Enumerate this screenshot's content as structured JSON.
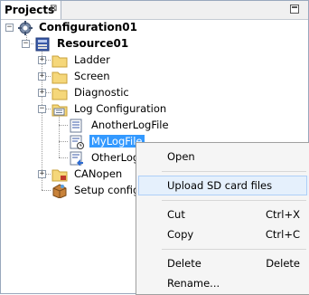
{
  "panel": {
    "title": "Projects",
    "close_glyph": "⊠"
  },
  "tree": {
    "root": "Configuration01",
    "resource": "Resource01",
    "folders": [
      "Ladder",
      "Screen",
      "Diagnostic",
      "Log Configuration"
    ],
    "log_files": [
      "AnotherLogFile",
      "MyLogFile",
      "OtherLogF"
    ],
    "after": [
      "CANopen",
      "Setup configu"
    ]
  },
  "context_menu": {
    "open": "Open",
    "upload": "Upload SD card files",
    "cut": "Cut",
    "cut_sc": "Ctrl+X",
    "copy": "Copy",
    "copy_sc": "Ctrl+C",
    "delete": "Delete",
    "delete_sc": "Delete",
    "rename": "Rename..."
  },
  "colors": {
    "selection": "#3399ff",
    "folder": "#f5d77a",
    "menu_hover": "#e5f0fc"
  }
}
